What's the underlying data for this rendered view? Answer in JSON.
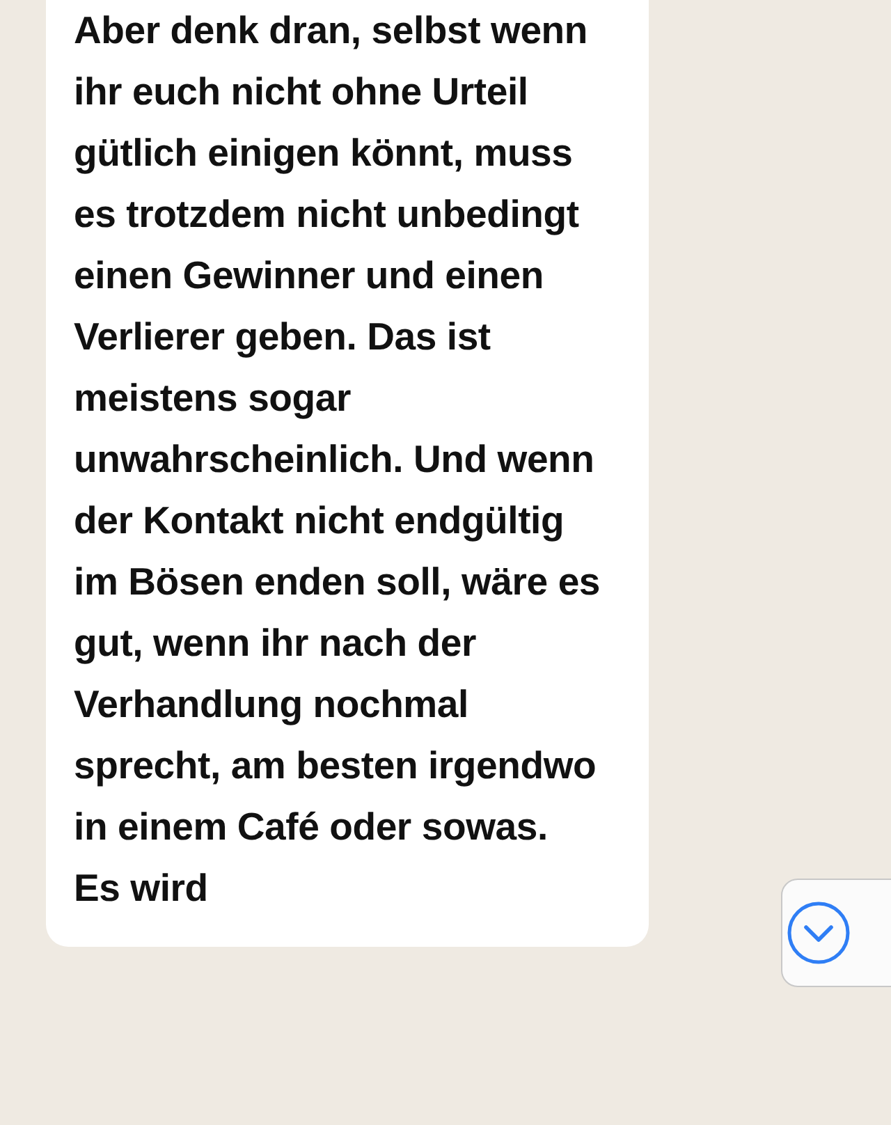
{
  "message": {
    "text": "Aber denk dran, selbst wenn ihr euch nicht ohne Urteil gütlich einigen könnt, muss es trotzdem nicht unbedingt einen Gewinner und einen Verlierer geben. Das ist meistens sogar unwahrscheinlich. Und wenn der Kontakt nicht endgültig im Bösen enden soll, wäre es gut, wenn ihr nach der Verhandlung nochmal sprecht, am besten irgendwo in einem Café oder sowas. Es wird"
  }
}
